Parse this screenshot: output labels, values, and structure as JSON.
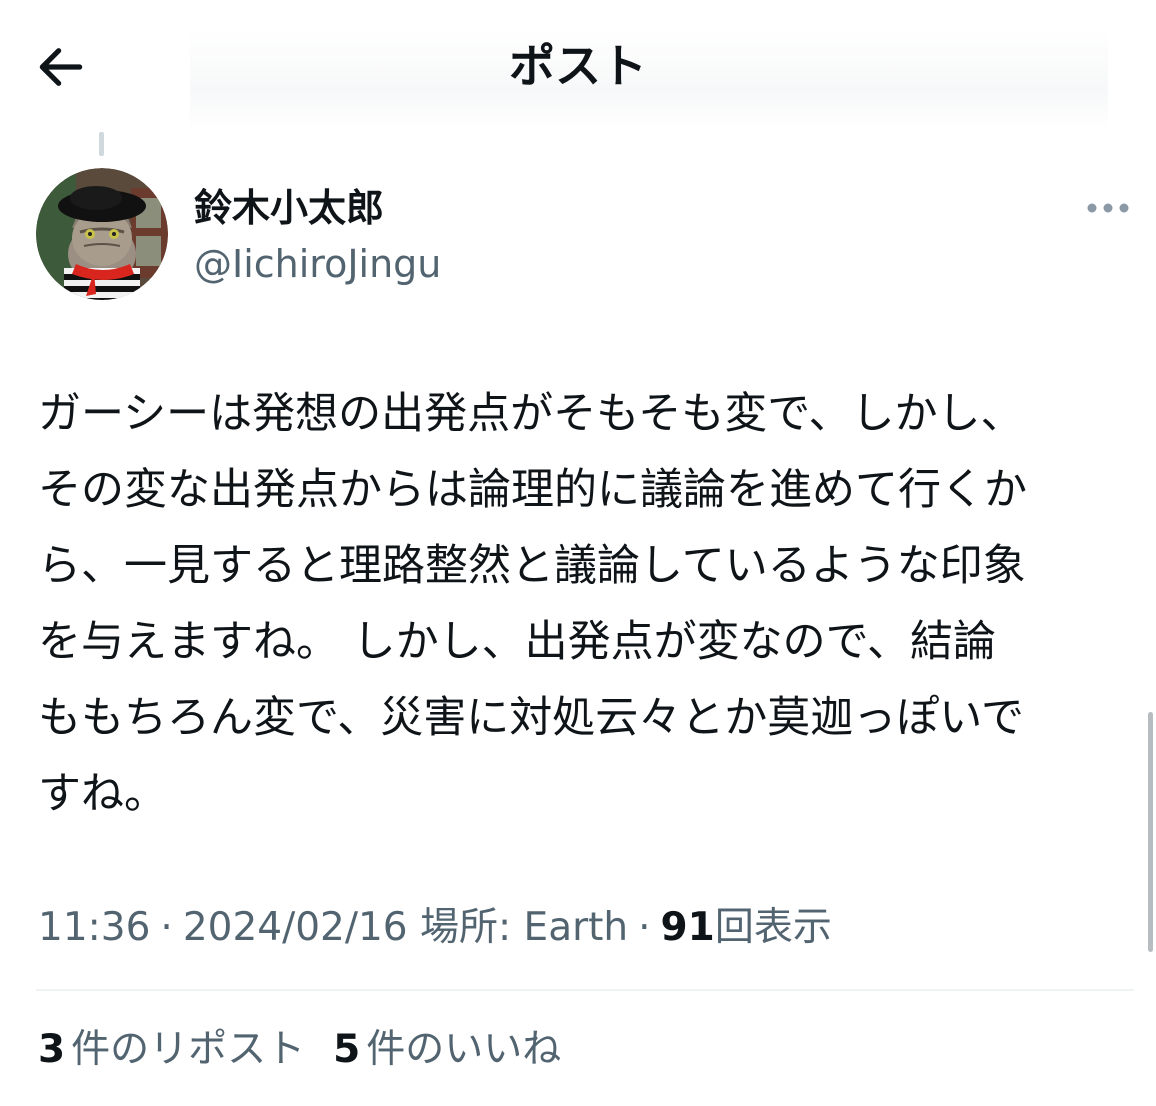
{
  "header": {
    "back_icon": "arrow-left-icon",
    "title": "ポスト"
  },
  "author": {
    "name": "鈴木小太郎",
    "handle": "@IichiroJingu",
    "avatar_icon": "cat-avatar",
    "more_icon": "more-horizontal-icon"
  },
  "post": {
    "lines": [
      "ガーシーは発想の出発点がそもそも変で、しかし、",
      "その変な出発点からは論理的に議論を進めて行くか",
      "ら、一見すると理路整然と議論しているような印象",
      "を与えますね。 しかし、出発点が変なので、結論",
      "ももちろん変で、災害に対処云々とか莫迦っぽいで",
      "すね。"
    ]
  },
  "meta": {
    "time": "11:36",
    "date": "2024/02/16",
    "location": "場所: Earth",
    "views_count": "91",
    "views_label": "回表示",
    "separator": "·"
  },
  "stats": {
    "reposts_count": "3",
    "reposts_label": "件のリポスト",
    "likes_count": "5",
    "likes_label": "件のいいね"
  },
  "colors": {
    "text_primary": "#0f1419",
    "text_secondary": "#536471",
    "divider": "#eff3f4"
  }
}
